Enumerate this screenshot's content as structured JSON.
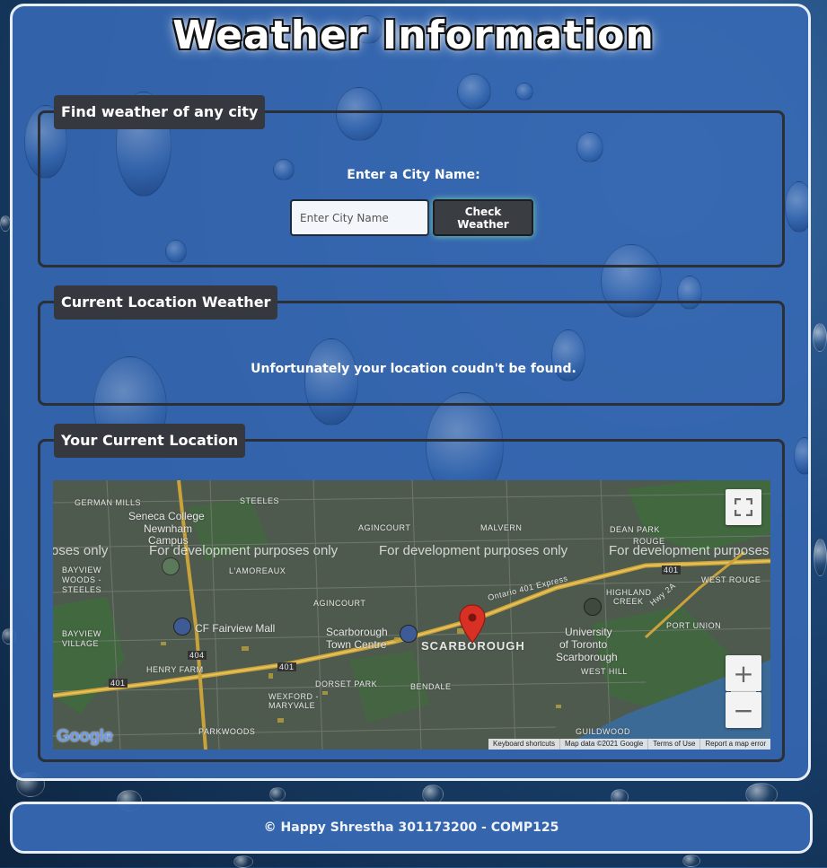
{
  "page": {
    "title": "Weather Information",
    "background_color": "#1d4778",
    "card_color": "#3769b4",
    "panel_border_color": "#2b2f36"
  },
  "search_panel": {
    "legend": "Find weather of any city",
    "prompt": "Enter a City Name:",
    "input_placeholder": "Enter City Name",
    "input_value": "",
    "button_label": "Check Weather"
  },
  "current_weather_panel": {
    "legend": "Current Location Weather",
    "message": "Unfortunately your location coudn't be found."
  },
  "location_panel": {
    "legend": "Your Current Location",
    "map": {
      "dev_watermark": [
        "oses only",
        "For development purposes only",
        "For development purposes only",
        "For development purposes"
      ],
      "place_labels": [
        "GERMAN MILLS",
        "STEELES",
        "Seneca College",
        "Newnham",
        "Campus",
        "AGINCOURT",
        "MALVERN",
        "DEAN PARK",
        "BAYVIEW",
        "WOODS -",
        "STEELES",
        "L'AMOREAUX",
        "ROUGE",
        "AGINCOURT",
        "HIGHLAND",
        "CREEK",
        "WEST ROUGE",
        "CF Fairview Mall",
        "Scarborough",
        "Town Centre",
        "SCARBOROUGH",
        "University",
        "of Toronto",
        "Scarborough",
        "PORT UNION",
        "BAYVIEW",
        "VILLAGE",
        "HENRY FARM",
        "DORSET PARK",
        "BENDALE",
        "WEST HILL",
        "WEXFORD -",
        "MARYVALE",
        "PARKWOODS",
        "GUILDWOOD"
      ],
      "road_labels": [
        "401",
        "404",
        "401",
        "401",
        "Ontario 401 Express",
        "Hwy 2A",
        "401"
      ],
      "logo_text": "Google",
      "zoom_in": "+",
      "zoom_out": "−",
      "attribution": [
        "Keyboard shortcuts",
        "Map data ©2021 Google",
        "Terms of Use",
        "Report a map error"
      ],
      "marker_color": "#d93025"
    }
  },
  "footer": {
    "text": "© Happy Shrestha 301173200 - COMP125"
  }
}
